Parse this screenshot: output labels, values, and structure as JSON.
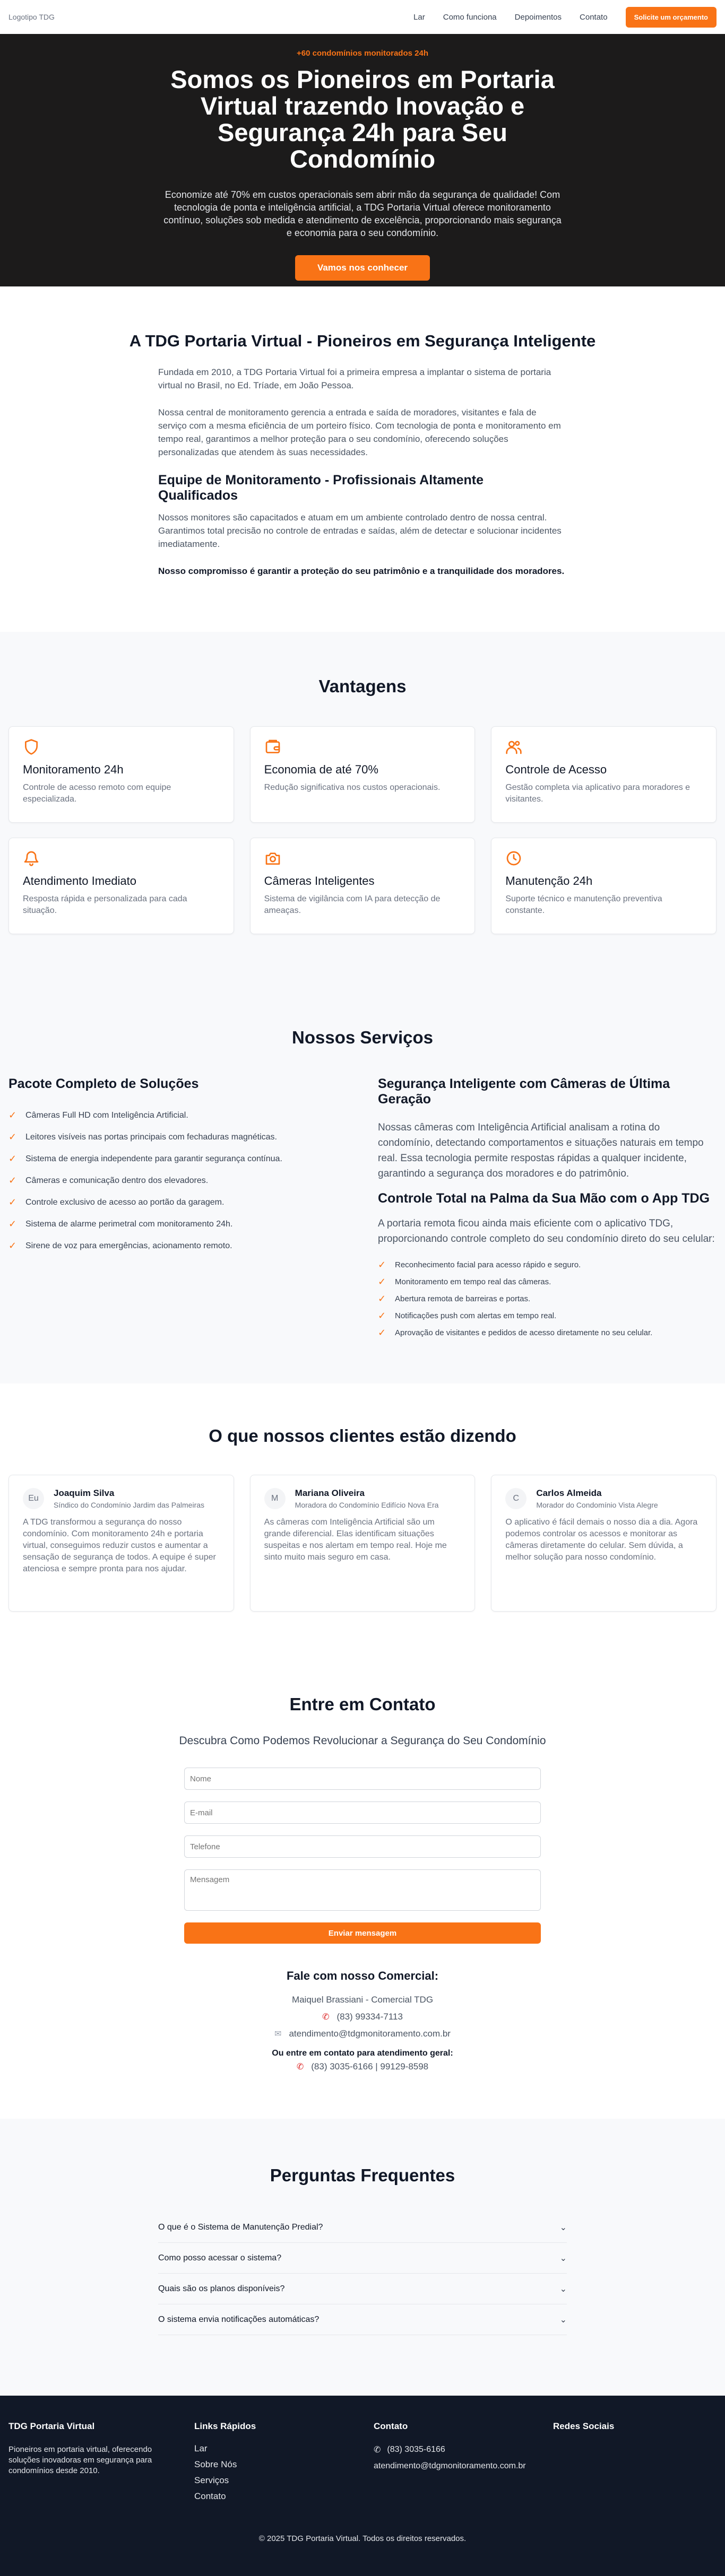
{
  "nav": {
    "logo_alt": "Logotipo TDG",
    "links": [
      "Lar",
      "Como funciona",
      "Depoimentos",
      "Contato"
    ],
    "cta": "Solicite um orçamento"
  },
  "hero": {
    "badge": "+60 condomínios monitorados 24h",
    "title": "Somos os Pioneiros em Portaria Virtual trazendo Inovação e Segurança 24h para Seu Condomínio",
    "subtitle": "Economize até 70% em custos operacionais sem abrir mão da segurança de qualidade! Com tecnologia de ponta e inteligência artificial, a TDG Portaria Virtual oferece monitoramento contínuo, soluções sob medida e atendimento de excelência, proporcionando mais segurança e economia para o seu condomínio.",
    "cta": "Vamos nos conhecer"
  },
  "about": {
    "title": "A TDG Portaria Virtual - Pioneiros em Segurança Inteligente",
    "p1": "Fundada em 2010, a TDG Portaria Virtual foi a primeira empresa a implantar o sistema de portaria virtual no Brasil, no Ed. Tríade, em João Pessoa.",
    "p2": "Nossa central de monitoramento gerencia a entrada e saída de moradores, visitantes e fala de serviço com a mesma eficiência de um porteiro físico. Com tecnologia de ponta e monitoramento em tempo real, garantimos a melhor proteção para o seu condomínio, oferecendo soluções personalizadas que atendem às suas necessidades.",
    "subtitle": "Equipe de Monitoramento - Profissionais Altamente Qualificados",
    "p3": "Nossos monitores são capacitados e atuam em um ambiente controlado dentro de nossa central. Garantimos total precisão no controle de entradas e saídas, além de detectar e solucionar incidentes imediatamente.",
    "p4": "Nosso compromisso é garantir a proteção do seu patrimônio e a tranquilidade dos moradores."
  },
  "advantages": {
    "title": "Vantagens",
    "items": [
      {
        "icon": "shield-icon",
        "title": "Monitoramento 24h",
        "text": "Controle de acesso remoto com equipe especializada."
      },
      {
        "icon": "wallet-icon",
        "title": "Economia de até 70%",
        "text": "Redução significativa nos custos operacionais."
      },
      {
        "icon": "users-icon",
        "title": "Controle de Acesso",
        "text": "Gestão completa via aplicativo para moradores e visitantes."
      },
      {
        "icon": "bell-icon",
        "title": "Atendimento Imediato",
        "text": "Resposta rápida e personalizada para cada situação."
      },
      {
        "icon": "camera-icon",
        "title": "Câmeras Inteligentes",
        "text": "Sistema de vigilância com IA para detecção de ameaças."
      },
      {
        "icon": "clock-icon",
        "title": "Manutenção 24h",
        "text": "Suporte técnico e manutenção preventiva constante."
      }
    ]
  },
  "services": {
    "title": "Nossos Serviços",
    "left_title": "Pacote Completo de Soluções",
    "left_items": [
      "Câmeras Full HD com Inteligência Artificial.",
      "Leitores visíveis nas portas principais com fechaduras magnéticas.",
      "Sistema de energia independente para garantir segurança contínua.",
      "Câmeras e comunicação dentro dos elevadores.",
      "Controle exclusivo de acesso ao portão da garagem.",
      "Sistema de alarme perimetral com monitoramento 24h.",
      "Sirene de voz para emergências, acionamento remoto."
    ],
    "right_title": "Segurança Inteligente com Câmeras de Última Geração",
    "right_p": "Nossas câmeras com Inteligência Artificial analisam a rotina do condomínio, detectando comportamentos e situações naturais em tempo real. Essa tecnologia permite respostas rápidas a qualquer incidente, garantindo a segurança dos moradores e do patrimônio.",
    "app_title": "Controle Total na Palma da Sua Mão com o App TDG",
    "app_p": "A portaria remota ficou ainda mais eficiente com o aplicativo TDG, proporcionando controle completo do seu condomínio direto do seu celular:",
    "app_items": [
      "Reconhecimento facial para acesso rápido e seguro.",
      "Monitoramento em tempo real das câmeras.",
      "Abertura remota de barreiras e portas.",
      "Notificações push com alertas em tempo real.",
      "Aprovação de visitantes e pedidos de acesso diretamente no seu celular."
    ]
  },
  "testimonials": {
    "title": "O que nossos clientes estão dizendo",
    "items": [
      {
        "initial": "Eu",
        "name": "Joaquim Silva",
        "role": "Síndico do Condomínio Jardim das Palmeiras",
        "text": "A TDG transformou a segurança do nosso condomínio. Com monitoramento 24h e portaria virtual, conseguimos reduzir custos e aumentar a sensação de segurança de todos. A equipe é super atenciosa e sempre pronta para nos ajudar."
      },
      {
        "initial": "M",
        "name": "Mariana Oliveira",
        "role": "Moradora do Condomínio Edifício Nova Era",
        "text": "As câmeras com Inteligência Artificial são um grande diferencial. Elas identificam situações suspeitas e nos alertam em tempo real. Hoje me sinto muito mais seguro em casa."
      },
      {
        "initial": "C",
        "name": "Carlos Almeida",
        "role": "Morador do Condomínio Vista Alegre",
        "text": "O aplicativo é fácil demais o nosso dia a dia. Agora podemos controlar os acessos e monitorar as câmeras diretamente do celular. Sem dúvida, a melhor solução para nosso condomínio."
      }
    ]
  },
  "contact": {
    "title": "Entre em Contato",
    "subtitle": "Descubra Como Podemos Revolucionar a Segurança do Seu Condomínio",
    "placeholders": {
      "name": "Nome",
      "email": "E-mail",
      "phone": "Telefone",
      "message": "Mensagem"
    },
    "submit": "Enviar mensagem",
    "commercial_title": "Fale com nosso Comercial:",
    "commercial_name": "Maiquel Brassiani - Comercial TDG",
    "commercial_phone": "(83) 99334-7113",
    "commercial_email": "atendimento@tdgmonitoramento.com.br",
    "general_title": "Ou entre em contato para atendimento geral:",
    "general_phones": "(83) 3035-6166 | 99129-8598"
  },
  "faq": {
    "title": "Perguntas Frequentes",
    "items": [
      "O que é o Sistema de Manutenção Predial?",
      "Como posso acessar o sistema?",
      "Quais são os planos disponíveis?",
      "O sistema envia notificações automáticas?"
    ]
  },
  "footer": {
    "brand": "TDG Portaria Virtual",
    "desc": "Pioneiros em portaria virtual, oferecendo soluções inovadoras em segurança para condomínios desde 2010.",
    "links_title": "Links Rápidos",
    "links": [
      "Lar",
      "Sobre Nós",
      "Serviços",
      "Contato"
    ],
    "contact_title": "Contato",
    "phone": "(83) 3035-6166",
    "email": "atendimento@tdgmonitoramento.com.br",
    "social_title": "Redes Sociais",
    "copyright": "© 2025 TDG Portaria Virtual. Todos os direitos reservados."
  },
  "colors": {
    "accent": "#f97316",
    "hero_bg": "#1c1b1b",
    "footer_bg": "#111827",
    "section_bg": "#f8f9fb"
  }
}
